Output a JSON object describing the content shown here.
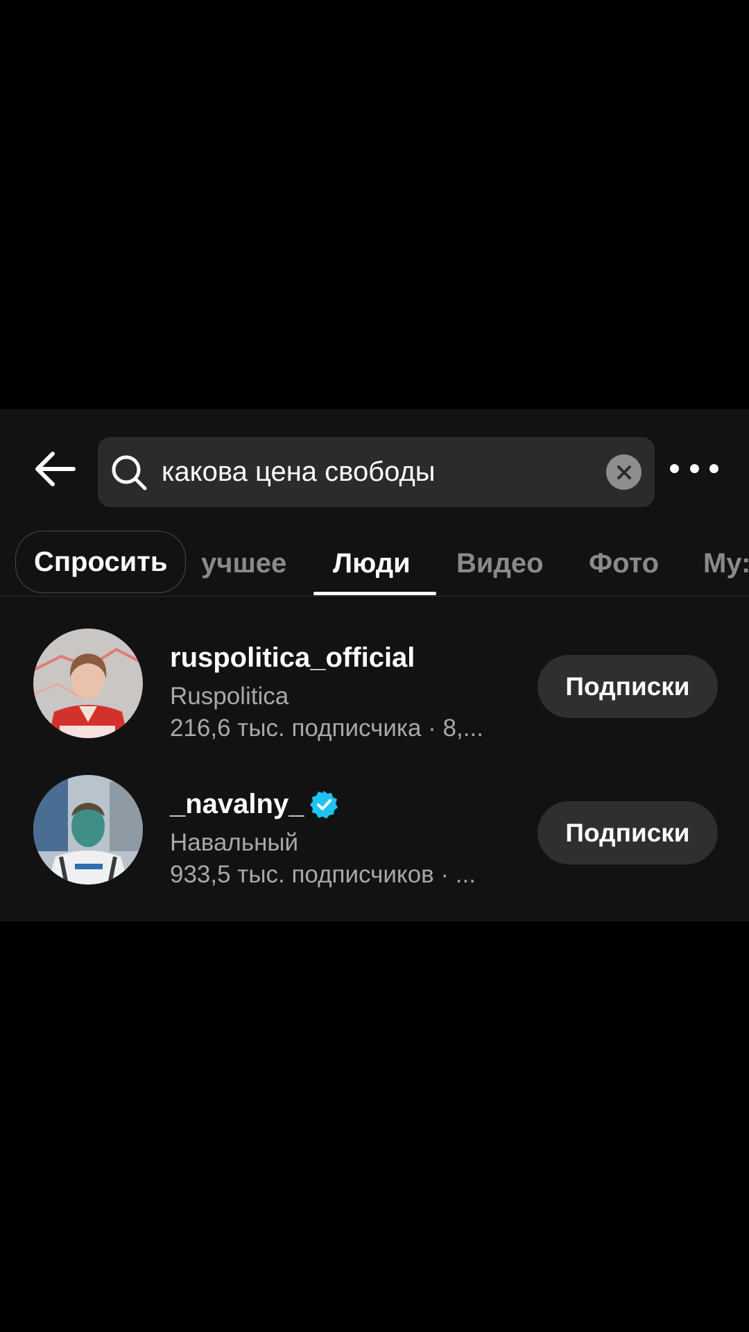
{
  "search": {
    "query": "какова цена свободы"
  },
  "icons": {
    "back": "arrow-left-icon",
    "search": "search-icon",
    "clear": "clear-x-icon",
    "more": "more-horizontal-icon",
    "verified": "verified-badge-icon"
  },
  "tabs": [
    {
      "label": "Спросить",
      "active": false
    },
    {
      "label": "учшее",
      "active": false
    },
    {
      "label": "Люди",
      "active": true
    },
    {
      "label": "Видео",
      "active": false
    },
    {
      "label": "Фото",
      "active": false
    },
    {
      "label": "Му:",
      "active": false
    }
  ],
  "users": [
    {
      "username": "ruspolitica_official",
      "verified": false,
      "display_name": "Ruspolitica",
      "stats": "216,6 тыс. подписчика · 8,...",
      "button": "Подписки"
    },
    {
      "username": "_navalny_",
      "verified": true,
      "display_name": "Навальный",
      "stats": "933,5 тыс. подписчиков · ...",
      "button": "Подписки"
    }
  ],
  "colors": {
    "background": "#000000",
    "panel": "#121212",
    "search_box": "#2b2b2b",
    "button": "#2f2f2f",
    "secondary_text": "#a8a8a8",
    "verified": "#20c3f2"
  }
}
